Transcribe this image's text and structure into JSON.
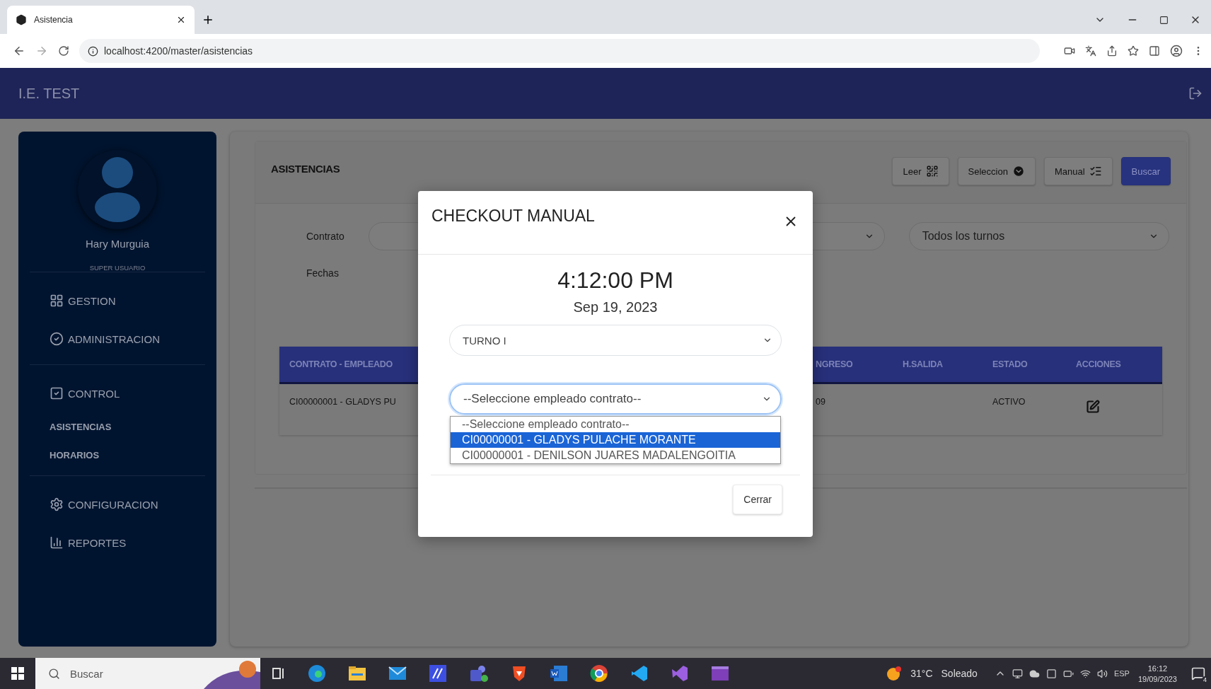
{
  "browser": {
    "tab_title": "Asistencia",
    "url": "localhost:4200/master/asistencias"
  },
  "header": {
    "title": "I.E. TEST"
  },
  "sidebar": {
    "user_name": "Hary Murguia",
    "role": "SUPER USUARIO",
    "groups": [
      {
        "items": [
          {
            "label": "GESTION",
            "kind": "section"
          },
          {
            "label": "ADMINISTRACION",
            "kind": "section"
          }
        ]
      },
      {
        "items": [
          {
            "label": "CONTROL",
            "kind": "section"
          },
          {
            "label": "ASISTENCIAS",
            "kind": "link"
          },
          {
            "label": "HORARIOS",
            "kind": "link"
          }
        ]
      },
      {
        "items": [
          {
            "label": "CONFIGURACION",
            "kind": "section"
          },
          {
            "label": "REPORTES",
            "kind": "section"
          }
        ]
      }
    ]
  },
  "panel": {
    "title": "ASISTENCIAS",
    "buttons": [
      {
        "label": "Leer",
        "kind": "scan"
      },
      {
        "label": "Seleccion",
        "kind": "dropdown"
      },
      {
        "label": "Manual",
        "kind": "manual"
      },
      {
        "label": "Buscar",
        "kind": "primary"
      }
    ],
    "filters": {
      "contrato_label": "Contrato",
      "turno_select": "Todos los turnos",
      "fechas_label": "Fechas"
    },
    "table": {
      "columns": [
        "CONTRATO - EMPLEADO",
        "NGRESO",
        "H.SALIDA",
        "ESTADO",
        "ACCIONES"
      ],
      "rows": [
        {
          "contrato_empleado": "CI00000001 - GLADYS PU",
          "ingreso": "09",
          "estado": "ACTIVO"
        }
      ]
    }
  },
  "modal": {
    "title": "CHECKOUT MANUAL",
    "time": "4:12:00 PM",
    "date": "Sep 19, 2023",
    "turno_select": "TURNO I",
    "employee_select": {
      "value": "--Seleccione empleado contrato--",
      "focused": true,
      "expanded": true,
      "options": [
        {
          "label": "--Seleccione empleado contrato--",
          "highlighted": false
        },
        {
          "label": "CI00000001 - GLADYS PULACHE MORANTE",
          "highlighted": true
        },
        {
          "label": "CI00000001 - DENILSON JUARES MADALENGOITIA",
          "highlighted": false
        }
      ]
    },
    "close_button": "Cerrar"
  },
  "taskbar": {
    "search_placeholder": "Buscar",
    "temperature": "31°C",
    "condition": "Soleado",
    "language": "ESP",
    "time": "16:12",
    "date": "19/09/2023",
    "notifications": "4"
  }
}
